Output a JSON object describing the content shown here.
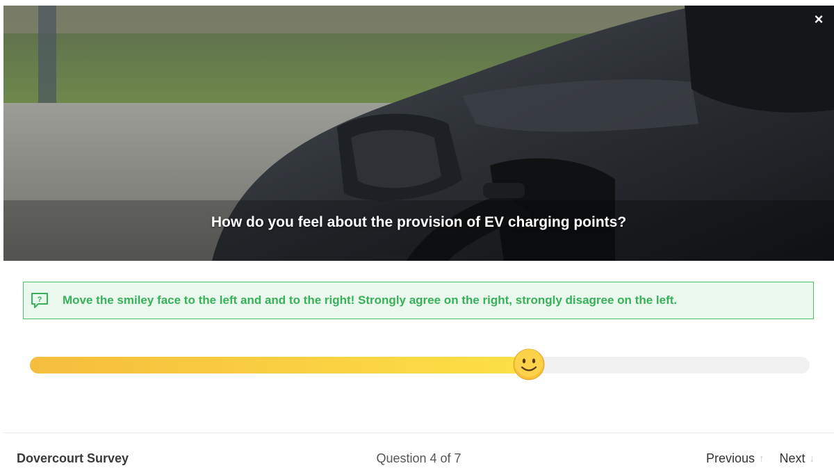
{
  "hero": {
    "question": "How do you feel about the provision of EV charging points?",
    "close_label": "×"
  },
  "hint": {
    "icon": "question-speech-bubble-icon",
    "text": "Move the smiley face to the left and and to the right! Strongly agree on the right, strongly disagree on the left."
  },
  "slider": {
    "value_fraction": 0.64,
    "knob_icon": "smiley-face-icon"
  },
  "footer": {
    "survey_name": "Dovercourt Survey",
    "progress_text": "Question 4 of 7",
    "previous_label": "Previous",
    "previous_arrow": "↑",
    "next_label": "Next",
    "next_arrow": "↓"
  },
  "colors": {
    "accent_green": "#37b15a",
    "slider_start": "#f6bd3d",
    "slider_end": "#fde046"
  }
}
